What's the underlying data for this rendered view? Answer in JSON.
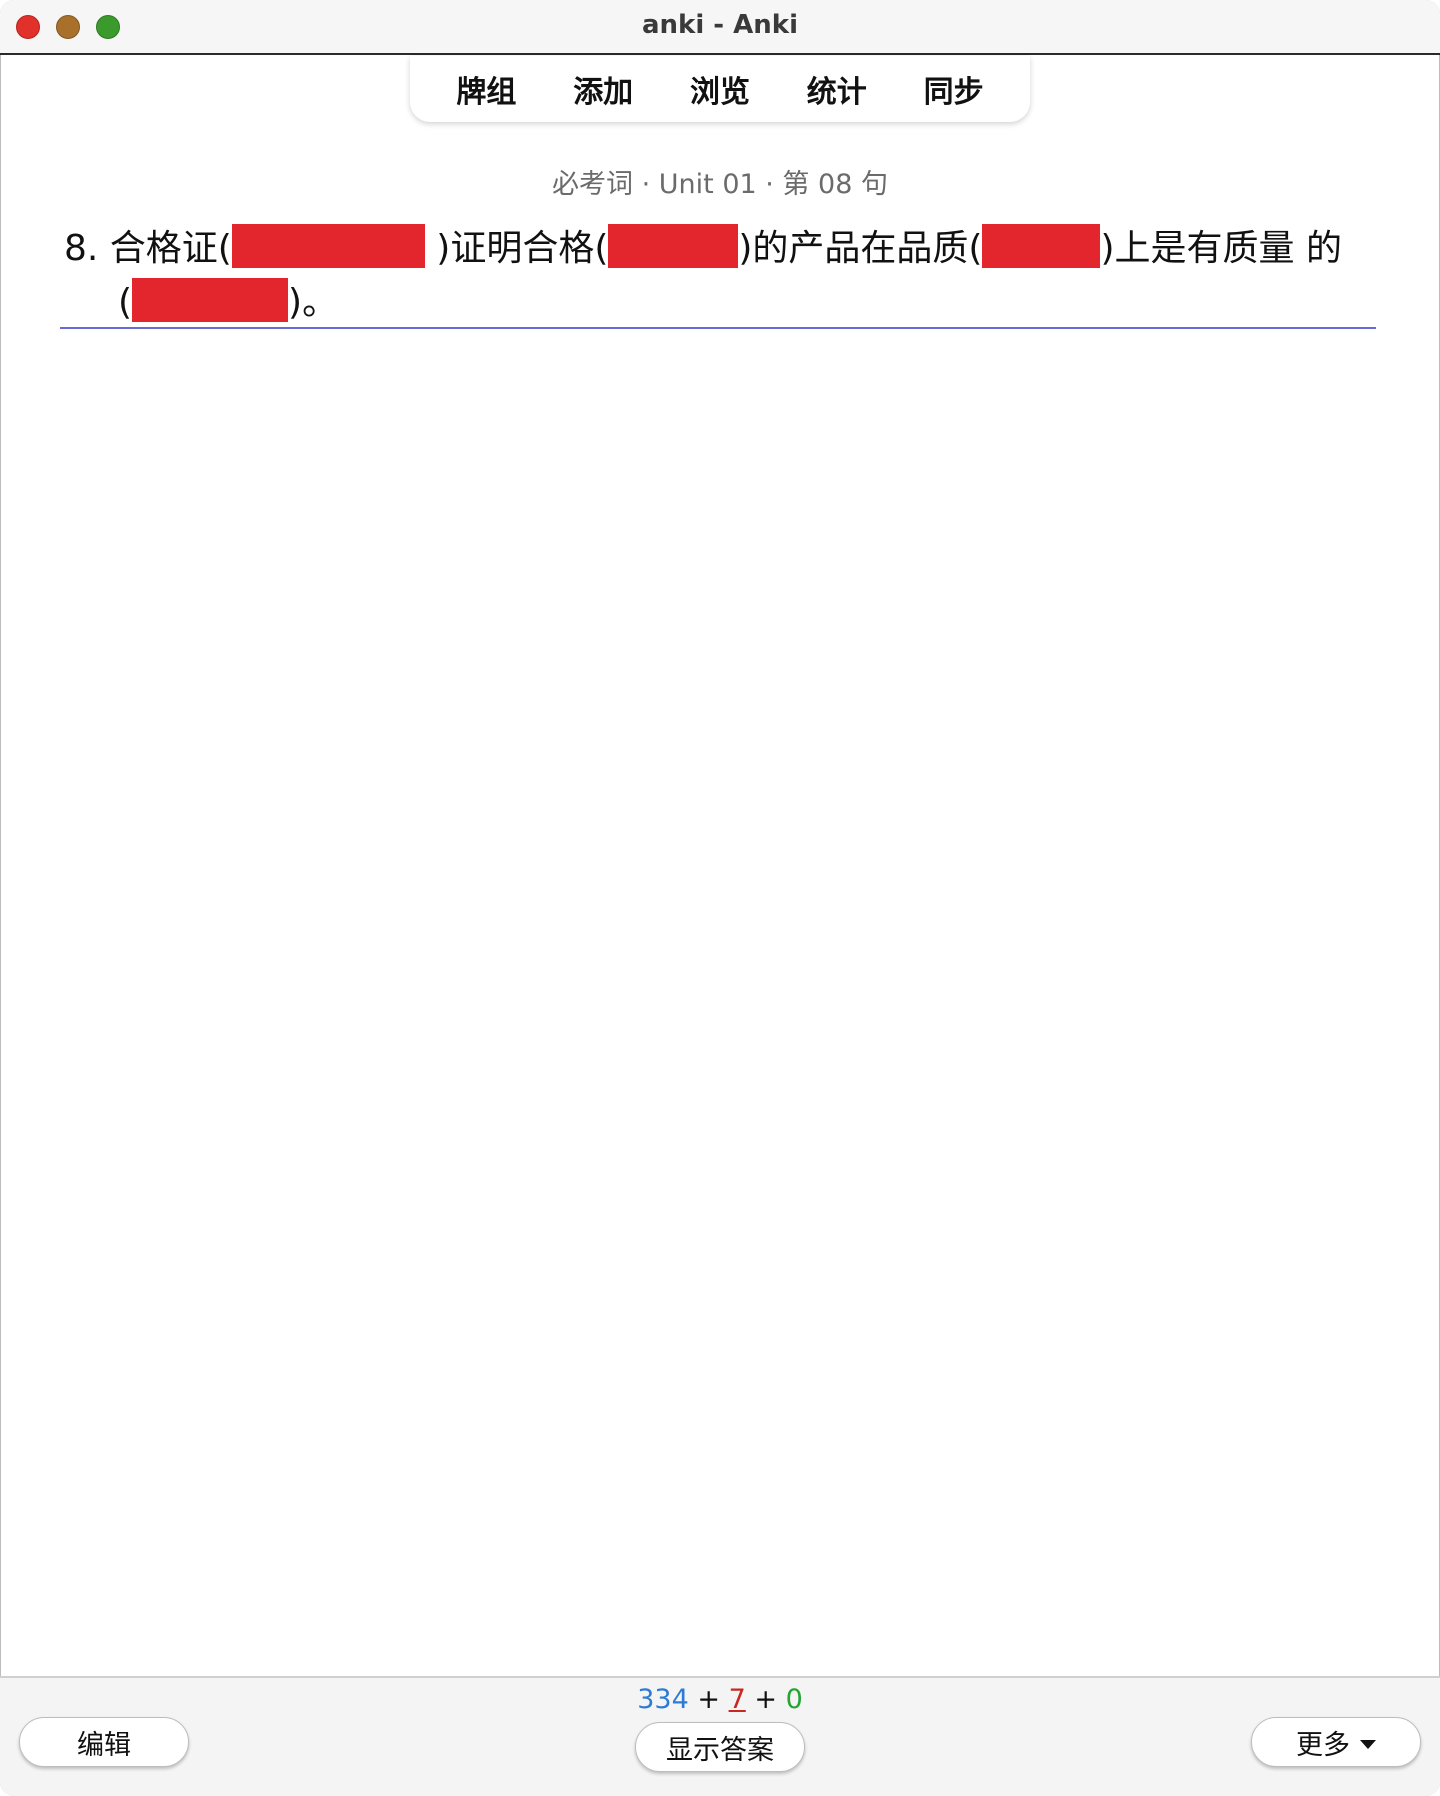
{
  "window": {
    "title": "anki - Anki"
  },
  "toolbar": {
    "items": [
      {
        "label": "牌组"
      },
      {
        "label": "添加"
      },
      {
        "label": "浏览"
      },
      {
        "label": "统计"
      },
      {
        "label": "同步"
      }
    ]
  },
  "card": {
    "meta": "必考词 · Unit 01 · 第 08 句",
    "sentence": {
      "seg1": "8. 合格证(",
      "seg2": " )证明合格(",
      "seg3": ")的产品在品质(",
      "seg4": ")上是有质量 的",
      "seg5": "(",
      "seg6": ")。"
    },
    "cloze_color": "#e3262e"
  },
  "bottom": {
    "counts": {
      "new": "334",
      "plus1": "+",
      "learn": "7",
      "plus2": "+",
      "review": "0"
    },
    "edit_label": "编辑",
    "show_answer_label": "显示答案",
    "more_label": "更多"
  },
  "colors": {
    "new": "#2e7bd6",
    "learn": "#c8281f",
    "review": "#23a532",
    "accent_line": "#6a6ad6"
  }
}
